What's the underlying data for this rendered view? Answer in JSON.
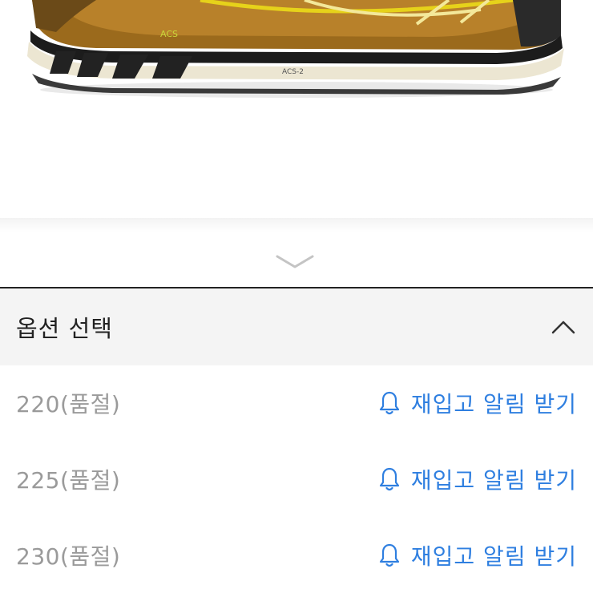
{
  "option_panel": {
    "title": "옵션 선택",
    "items": [
      {
        "size": "220(품절)",
        "action": "재입고 알림 받기"
      },
      {
        "size": "225(품절)",
        "action": "재입고 알림 받기"
      },
      {
        "size": "230(품절)",
        "action": "재입고 알림 받기"
      }
    ]
  },
  "shoe_sole_text": "ACS",
  "shoe_side_text": "ACS-2",
  "colors": {
    "accent_blue": "#2f7fe0",
    "header_bg": "#f4f4f4",
    "sold_out_text": "#9a9a9a",
    "shoe_upper_brown": "#a8741f",
    "shoe_accent_yellow": "#e6d21a",
    "sole_cream": "#ece6d2"
  },
  "icons": [
    "chevron-down-icon",
    "chevron-up-icon",
    "bell-icon"
  ]
}
